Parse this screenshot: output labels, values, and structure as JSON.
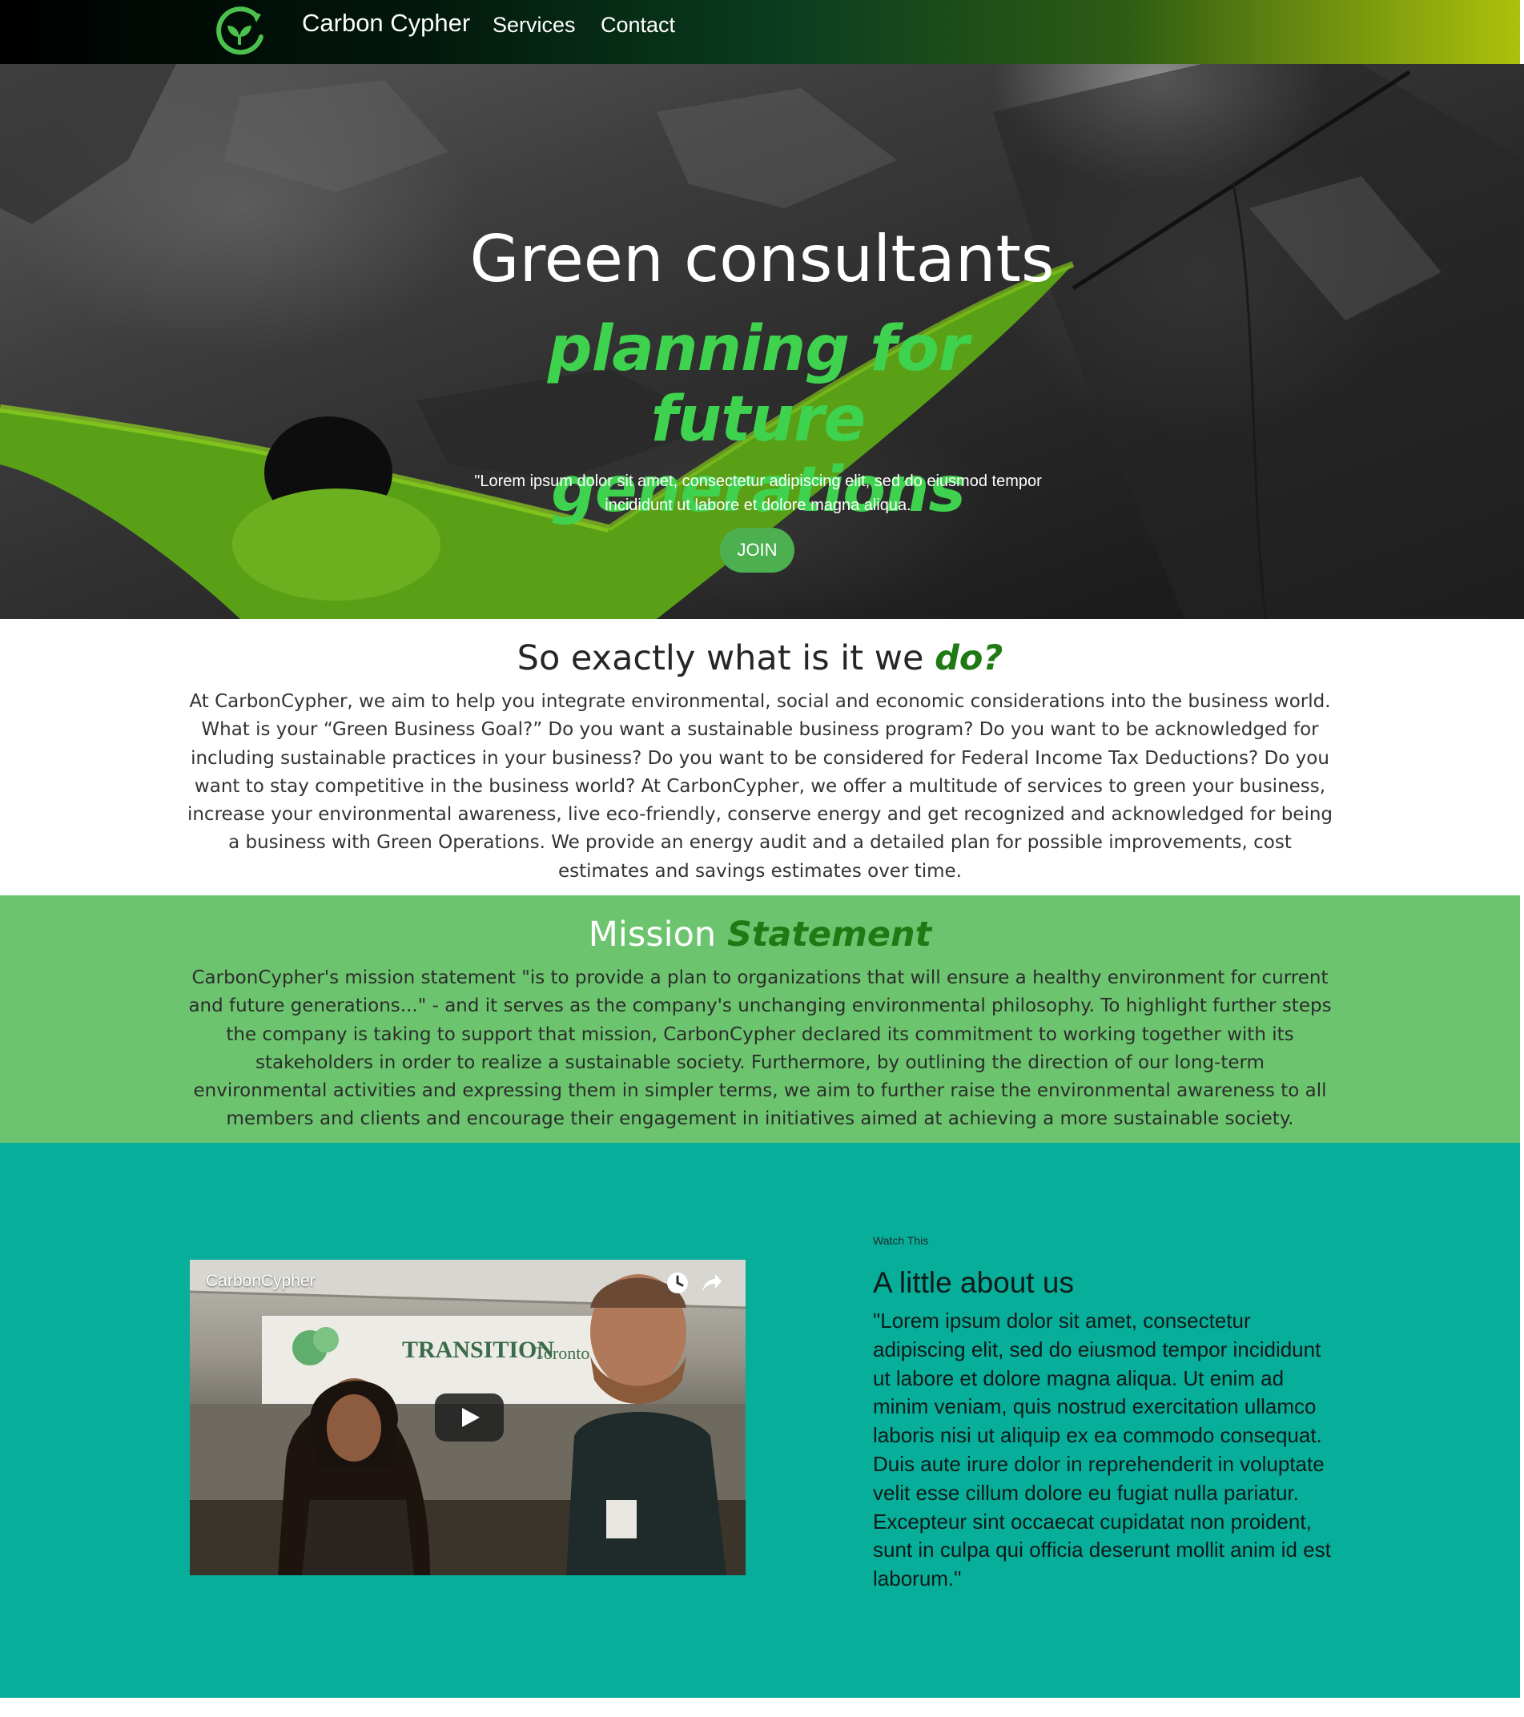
{
  "nav": {
    "brand": "Carbon Cypher",
    "links": [
      "Services",
      "Contact"
    ],
    "gradient_colors": [
      "#000000",
      "#0b3d1f",
      "#aec20a"
    ]
  },
  "hero": {
    "title": "Green consultants",
    "tagline": "planning for future generations",
    "quote": "\"Lorem ipsum dolor sit amet, consectetur adipiscing elit, sed do eiusmod tempor incididunt ut labore et dolore magna aliqua.",
    "cta_label": "JOIN",
    "accent_color": "#3fd24f",
    "button_color": "#4caf50"
  },
  "what_we_do": {
    "heading_plain": "So exactly what is it we ",
    "heading_accent": "do?",
    "body": "At CarbonCypher, we aim to help you integrate environmental, social and economic considerations into the business world. What is your “Green Business Goal?” Do you want a sustainable business program? Do you want to be acknowledged for including sustainable practices in your business? Do you want to be considered for Federal Income Tax Deductions? Do you want to stay competitive in the business world? At CarbonCypher, we offer a multitude of services to green your business, increase your environmental awareness, live eco-friendly, conserve energy and get recognized and acknowledged for being a business with Green Operations. We provide an energy audit and a detailed plan for possible improvements, cost estimates and savings estimates over time."
  },
  "mission": {
    "heading_plain": "Mission ",
    "heading_accent": "Statement",
    "body": "CarbonCypher's mission statement \"is to provide a plan to organizations that will ensure a healthy environment for current and future generations...\" - and it serves as the company's unchanging environmental philosophy. To highlight further steps the company is taking to support that mission, CarbonCypher declared its commitment to working together with its stakeholders in order to realize a sustainable society. Furthermore, by outlining the direction of our long-term environmental activities and expressing them in simpler terms, we aim to further raise the environmental awareness to all members and clients and encourage their engagement in initiatives aimed at achieving a more sustainable society.",
    "background_color": "#6cc56e"
  },
  "about": {
    "video": {
      "title": "CarbonCypher",
      "banner_text": "TRANSITION",
      "banner_subtext": "Toronto",
      "icons": [
        "clock-icon",
        "share-icon",
        "play-icon"
      ]
    },
    "eyebrow": "Watch This",
    "title": "A little about us",
    "body": "\"Lorem ipsum dolor sit amet, consectetur adipiscing elit, sed do eiusmod tempor incididunt ut labore et dolore magna aliqua. Ut enim ad minim veniam, quis nostrud exercitation ullamco laboris nisi ut aliquip ex ea commodo consequat. Duis aute irure dolor in reprehenderit in voluptate velit esse cillum dolore eu fugiat nulla pariatur. Excepteur sint occaecat cupidatat non proident, sunt in culpa qui officia deserunt mollit anim id est laborum.\"",
    "background_color": "#07ae9a"
  }
}
